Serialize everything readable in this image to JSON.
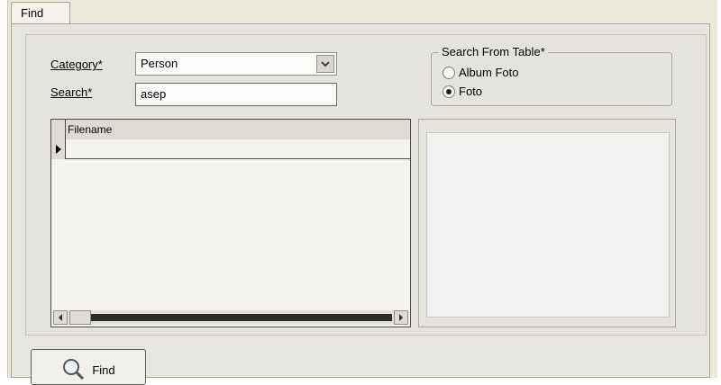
{
  "tab": {
    "label": "Find"
  },
  "form": {
    "category_label": "Category*",
    "category_value": "Person",
    "search_label": "Search*",
    "search_value": "asep"
  },
  "search_from_table": {
    "title": "Search From Table*",
    "options": [
      {
        "label": "Album Foto",
        "selected": false
      },
      {
        "label": "Foto",
        "selected": true
      }
    ]
  },
  "grid": {
    "columns": [
      "Filename"
    ],
    "rows": [
      ""
    ]
  },
  "buttons": {
    "find_label": "Find"
  },
  "icons": {
    "dropdown": "chevron-down-icon",
    "row_indicator": "row-pointer-icon",
    "scroll_left": "arrow-left-icon",
    "scroll_right": "arrow-right-icon",
    "find": "magnifier-icon"
  }
}
